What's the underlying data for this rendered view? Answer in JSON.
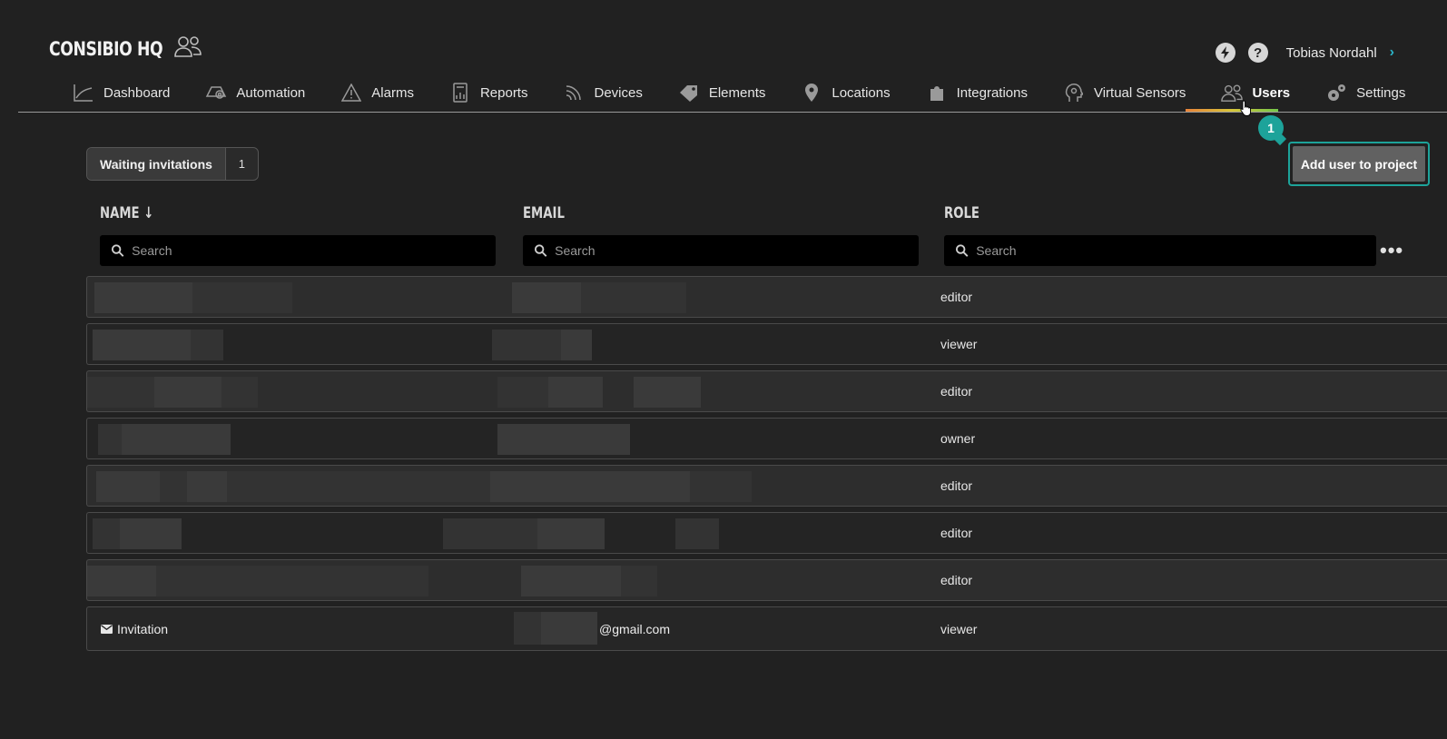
{
  "brand": {
    "title": "CONSIBIO HQ",
    "icon": "users-icon"
  },
  "top_right": {
    "bolt_icon": "lightning-icon",
    "help_label": "?",
    "user_name": "Tobias Nordahl",
    "chevron": "›"
  },
  "nav": [
    {
      "label": "Dashboard",
      "icon": "chart-line-icon"
    },
    {
      "label": "Automation",
      "icon": "automation-icon"
    },
    {
      "label": "Alarms",
      "icon": "warning-icon"
    },
    {
      "label": "Reports",
      "icon": "report-icon"
    },
    {
      "label": "Devices",
      "icon": "wifi-icon"
    },
    {
      "label": "Elements",
      "icon": "tag-icon"
    },
    {
      "label": "Locations",
      "icon": "map-pin-icon"
    },
    {
      "label": "Integrations",
      "icon": "puzzle-icon"
    },
    {
      "label": "Virtual Sensors",
      "icon": "head-icon"
    },
    {
      "label": "Users",
      "icon": "users-icon",
      "active": true
    },
    {
      "label": "Settings",
      "icon": "gears-icon"
    }
  ],
  "tour_badge": "1",
  "waiting": {
    "label": "Waiting invitations",
    "count": "1"
  },
  "add_user": {
    "label": "Add user to project"
  },
  "table": {
    "columns": {
      "name": "NAME ↓",
      "email": "EMAIL",
      "role": "ROLE"
    },
    "search_placeholder": "Search",
    "more": "•••",
    "rows": [
      {
        "role": "editor"
      },
      {
        "role": "viewer"
      },
      {
        "role": "editor"
      },
      {
        "role": "owner"
      },
      {
        "role": "editor"
      },
      {
        "role": "editor"
      },
      {
        "role": "editor"
      }
    ],
    "invitation": {
      "name": "Invitation",
      "email": "@gmail.com",
      "role": "viewer"
    }
  },
  "colors": {
    "accent": "#1da39a",
    "background": "#212121",
    "link": "#2ab3c7"
  }
}
